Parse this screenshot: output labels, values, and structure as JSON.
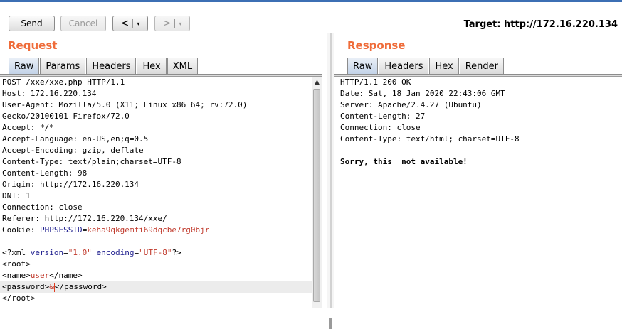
{
  "toolbar": {
    "send_label": "Send",
    "cancel_label": "Cancel",
    "back_glyph": "<",
    "forward_glyph": ">",
    "dropdown_glyph": "▾",
    "target_label": "Target: http://172.16.220.134"
  },
  "request": {
    "title": "Request",
    "tabs": [
      "Raw",
      "Params",
      "Headers",
      "Hex",
      "XML"
    ],
    "active_tab": "Raw",
    "headers": [
      "POST /xxe/xxe.php HTTP/1.1",
      "Host: 172.16.220.134",
      "User-Agent: Mozilla/5.0 (X11; Linux x86_64; rv:72.0)",
      "Gecko/20100101 Firefox/72.0",
      "Accept: */*",
      "Accept-Language: en-US,en;q=0.5",
      "Accept-Encoding: gzip, deflate",
      "Content-Type: text/plain;charset=UTF-8",
      "Content-Length: 98",
      "Origin: http://172.16.220.134",
      "DNT: 1",
      "Connection: close",
      "Referer: http://172.16.220.134/xxe/"
    ],
    "cookie": {
      "prefix": "Cookie: ",
      "name": "PHPSESSID",
      "eq": "=",
      "value": "keha9qkgemfi69dqcbe7rg0bjr"
    },
    "xml": {
      "decl_open": "<?xml ",
      "version_attr": "version",
      "version_value": "\"1.0\"",
      "encoding_attr": "encoding",
      "encoding_value": "\"UTF-8\"",
      "decl_close": "?>",
      "root_open": "<root>",
      "name_open": "<name>",
      "name_value": "user",
      "name_close": "</name>",
      "password_open": "<password>",
      "password_value": "&",
      "password_close": "</password>",
      "root_close": "</root>"
    }
  },
  "response": {
    "title": "Response",
    "tabs": [
      "Raw",
      "Headers",
      "Hex",
      "Render"
    ],
    "active_tab": "Raw",
    "lines": [
      "HTTP/1.1 200 OK",
      "Date: Sat, 18 Jan 2020 22:43:06 GMT",
      "Server: Apache/2.4.27 (Ubuntu)",
      "Content-Length: 27",
      "Connection: close",
      "Content-Type: text/html; charset=UTF-8"
    ],
    "body": "Sorry, this  not available!"
  },
  "icons": {
    "scroll_up": "▲"
  }
}
